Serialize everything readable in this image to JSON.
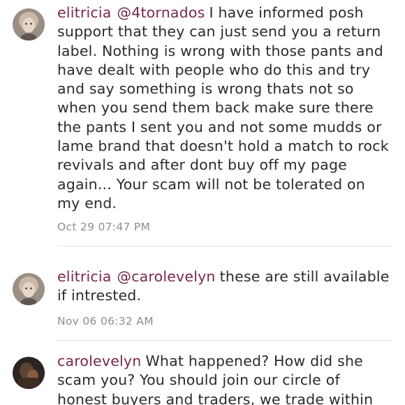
{
  "comments": [
    {
      "username": "elitricia",
      "mention": "@4tornados",
      "text": "I have informed posh support that they can just send you a return label. Nothing is wrong with those pants and have dealt with people who do this and try and say something is wrong thats not so when you send them back make sure there the pants I sent you and not some mudds or lame brand that doesn't hold a match to rock revivals and after dont buy off my page again... Your scam will not be tolerated on my end.",
      "timestamp": "Oct 29 07:47 PM"
    },
    {
      "username": "elitricia",
      "mention": "@carolevelyn",
      "text": "these are still available if intrested.",
      "timestamp": "Nov 06 06:32 AM"
    },
    {
      "username": "carolevelyn",
      "mention": "",
      "text": "What happened? How did she scam you? You should join our circle of honest buyers and traders, we trade within",
      "timestamp": ""
    }
  ]
}
